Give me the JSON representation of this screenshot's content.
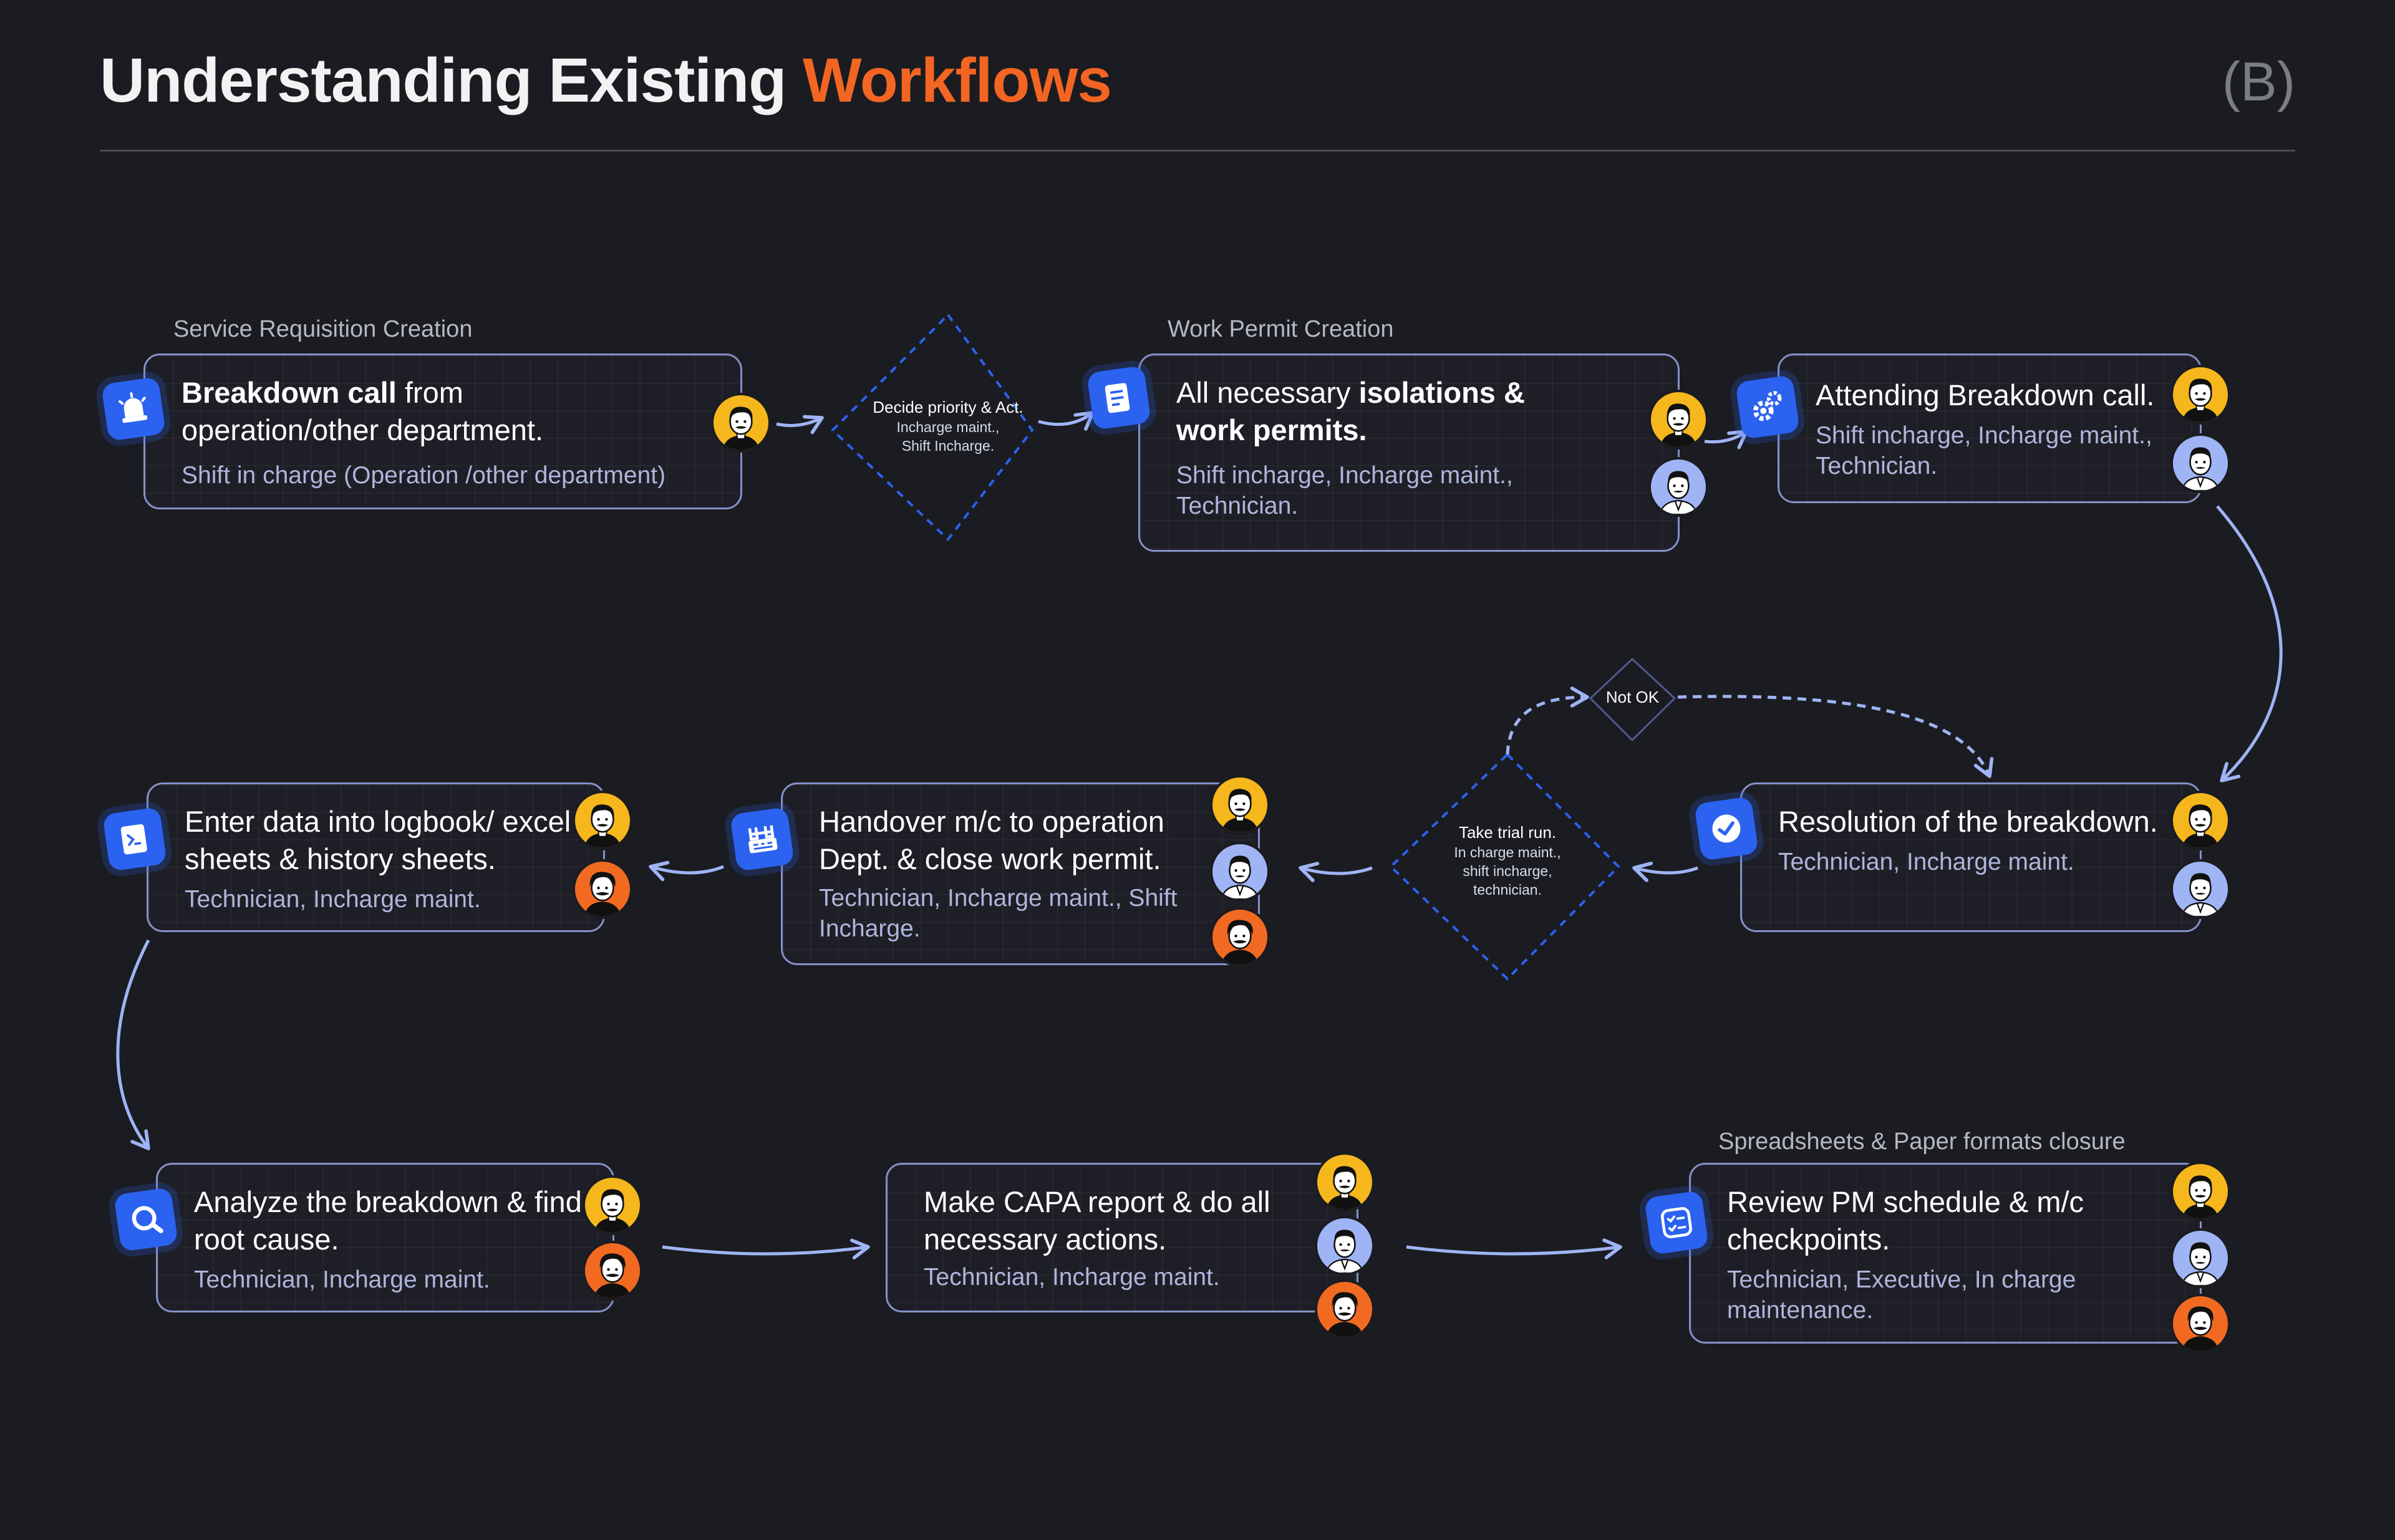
{
  "header": {
    "title_main": "Understanding Existing",
    "title_accent": "Workflows",
    "badge": "(B)"
  },
  "labels": {
    "service_requisition": "Service Requisition Creation",
    "work_permit": "Work Permit Creation",
    "spreadsheets_closure": "Spreadsheets & Paper formats closure"
  },
  "decisions": {
    "decide": {
      "title": "Decide priority & Act.",
      "sub1": "Incharge maint.,",
      "sub2": "Shift Incharge."
    },
    "trial": {
      "title": "Take trial run.",
      "sub1": "In charge maint.,",
      "sub2": "shift incharge,",
      "sub3": "technician."
    },
    "not_ok": "Not OK"
  },
  "steps": {
    "breakdown_call": {
      "title_bold": "Breakdown call",
      "title_rest": " from operation/other department.",
      "roles": "Shift in charge (Operation /other department)",
      "icon": "alarm-icon"
    },
    "work_permits": {
      "title_plain": "All necessary ",
      "title_bold": "isolations & work permits.",
      "roles": "Shift incharge, Incharge maint., Technician.",
      "icon": "document-icon"
    },
    "attending": {
      "title": "Attending Breakdown call.",
      "roles": "Shift incharge, Incharge maint., Technician.",
      "icon": "gears-icon"
    },
    "resolution": {
      "title": "Resolution of the breakdown.",
      "roles": "Technician, Incharge maint.",
      "icon": "check-icon"
    },
    "handover": {
      "title": "Handover m/c to operation Dept. & close work permit.",
      "roles": "Technician, Incharge maint., Shift Incharge.",
      "icon": "machine-icon"
    },
    "logbook": {
      "title": "Enter data into logbook/ excel sheets & history sheets.",
      "roles": "Technician, Incharge maint.",
      "icon": "logbook-icon"
    },
    "analyze": {
      "title": "Analyze the breakdown & find root cause.",
      "roles": "Technician, Incharge maint.",
      "icon": "search-icon"
    },
    "capa": {
      "title": "Make CAPA report & do all necessary actions.",
      "roles": "Technician, Incharge maint."
    },
    "review": {
      "title": "Review PM schedule & m/c checkpoints.",
      "roles": "Technician, Executive, In charge maintenance.",
      "icon": "checklist-icon"
    }
  },
  "colors": {
    "accent": "#f26522",
    "card_border": "#8491c8",
    "icon_blue": "#2b62f0",
    "avatar_yellow": "#f6b71d",
    "avatar_blue": "#9fb4f5",
    "avatar_orange": "#f26a22",
    "connector": "#9fb4f5"
  }
}
